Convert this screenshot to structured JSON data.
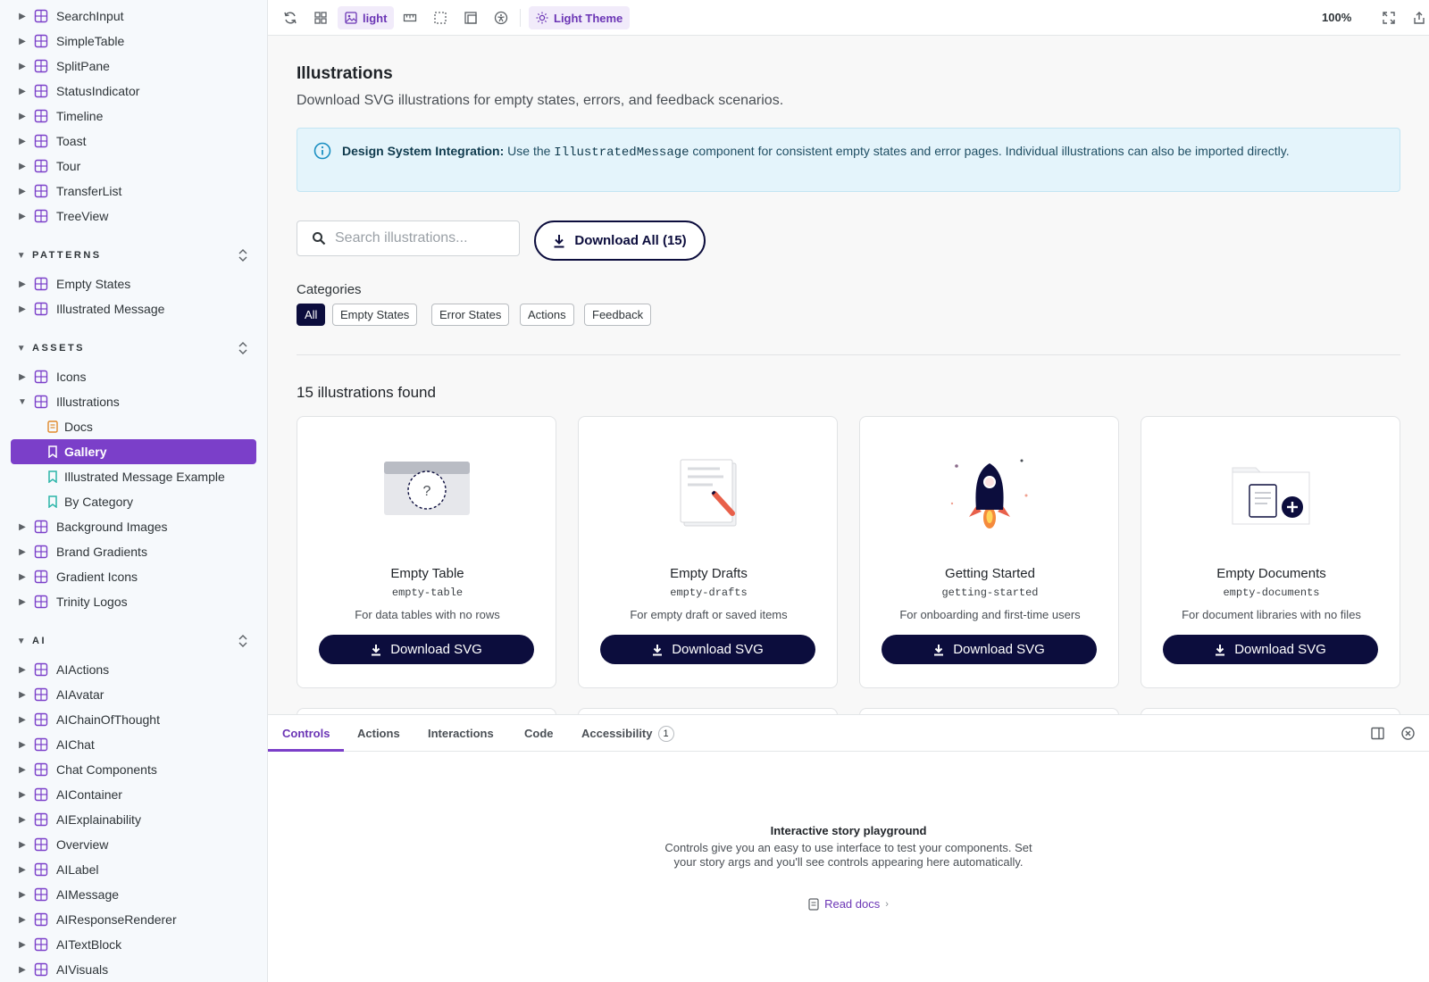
{
  "sidebar": {
    "top_items": [
      "SearchInput",
      "SimpleTable",
      "SplitPane",
      "StatusIndicator",
      "Timeline",
      "Toast",
      "Tour",
      "TransferList",
      "TreeView"
    ],
    "patterns": {
      "title": "PATTERNS",
      "items": [
        "Empty States",
        "Illustrated Message"
      ]
    },
    "assets": {
      "title": "ASSETS",
      "items_before": [
        "Icons"
      ],
      "expanded": "Illustrations",
      "children": [
        "Docs",
        "Gallery",
        "Illustrated Message Example",
        "By Category"
      ],
      "selected_child": "Gallery",
      "items_after": [
        "Background Images",
        "Brand Gradients",
        "Gradient Icons",
        "Trinity Logos"
      ]
    },
    "ai": {
      "title": "AI",
      "items": [
        "AIActions",
        "AIAvatar",
        "AIChainOfThought",
        "AIChat",
        "Chat Components",
        "AIContainer",
        "AIExplainability",
        "Overview",
        "AILabel",
        "AIMessage",
        "AIResponseRenderer",
        "AITextBlock",
        "AIVisuals"
      ]
    }
  },
  "toolbar": {
    "background_label": "light",
    "theme_label": "Light Theme",
    "zoom": "100%"
  },
  "main": {
    "title": "Illustrations",
    "subtitle": "Download SVG illustrations for empty states, errors, and feedback scenarios.",
    "info": {
      "bold": "Design System Integration:",
      "pre": " Use the ",
      "code": "IllustratedMessage",
      "post": " component for consistent empty states and error pages. Individual illustrations can also be imported directly."
    },
    "search_placeholder": "Search illustrations...",
    "download_all": "Download All (15)",
    "categories_label": "Categories",
    "categories": [
      "All",
      "Empty States",
      "Error States",
      "Actions",
      "Feedback"
    ],
    "active_category": "All",
    "result_count": "15 illustrations found",
    "cards": [
      {
        "title": "Empty Table",
        "code": "empty-table",
        "desc": "For data tables with no rows",
        "button": "Download SVG"
      },
      {
        "title": "Empty Drafts",
        "code": "empty-drafts",
        "desc": "For empty draft or saved items",
        "button": "Download SVG"
      },
      {
        "title": "Getting Started",
        "code": "getting-started",
        "desc": "For onboarding and first-time users",
        "button": "Download SVG"
      },
      {
        "title": "Empty Documents",
        "code": "empty-documents",
        "desc": "For document libraries with no files",
        "button": "Download SVG"
      }
    ]
  },
  "panel": {
    "tabs": [
      "Controls",
      "Actions",
      "Interactions",
      "Code",
      "Accessibility"
    ],
    "accessibility_badge": "1",
    "empty_title": "Interactive story playground",
    "empty_desc": "Controls give you an easy to use interface to test your components. Set your story args and you'll see controls appearing here automatically.",
    "read_docs": "Read docs"
  },
  "colors": {
    "accent": "#7b3fc9",
    "navy": "#0c0d3d",
    "info_bg": "#e4f4fb"
  }
}
